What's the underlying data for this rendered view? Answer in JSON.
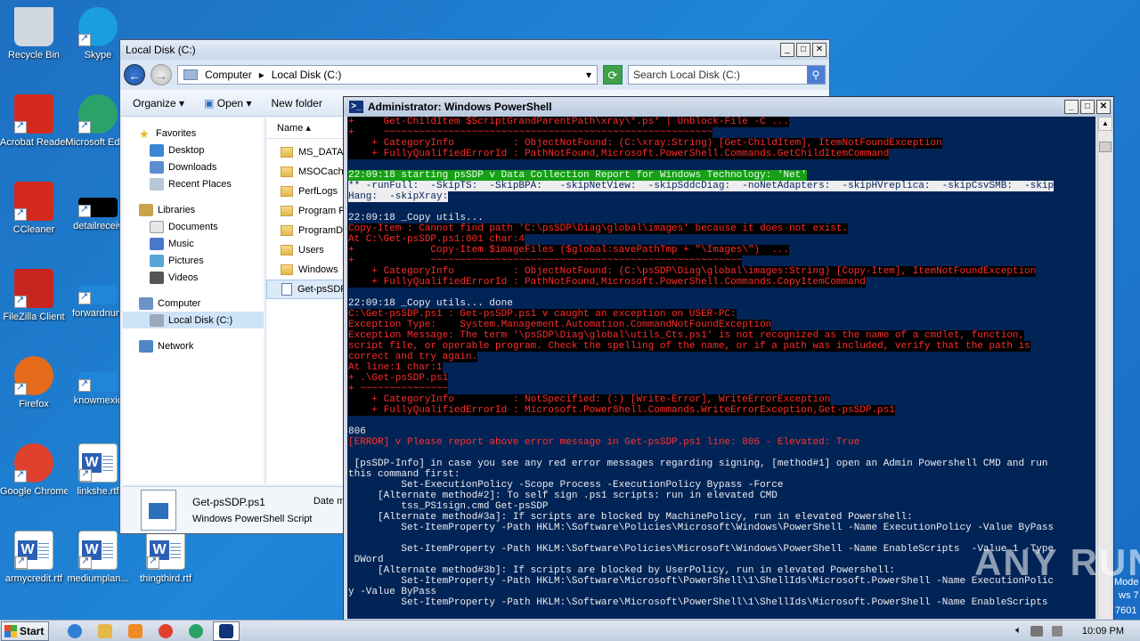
{
  "desktop_icons": [
    {
      "label": "Recycle Bin",
      "icon": "recycle-bin-icon",
      "color": "#cfd8e0"
    },
    {
      "label": "Skype",
      "icon": "skype-icon",
      "color": "#1a9ee2"
    },
    {
      "label": "Acrobat Reader DC",
      "icon": "acrobat-icon",
      "color": "#d32a1d"
    },
    {
      "label": "Microsoft Edge",
      "icon": "edge-icon",
      "color": "#2aa36a"
    },
    {
      "label": "CCleaner",
      "icon": "ccleaner-icon",
      "color": "#d32a1d"
    },
    {
      "label": "detailreceiv",
      "icon": "blank-file-icon",
      "color": "#000000"
    },
    {
      "label": "FileZilla Client",
      "icon": "filezilla-icon",
      "color": "#c9251f"
    },
    {
      "label": "forwardnum",
      "icon": "blank-file-icon",
      "color": "#1f86d8"
    },
    {
      "label": "Firefox",
      "icon": "firefox-icon",
      "color": "#e56a1a"
    },
    {
      "label": "knowmexic",
      "icon": "blank-file-icon",
      "color": "#1f86d8"
    },
    {
      "label": "Google Chrome",
      "icon": "chrome-icon",
      "color": "#e0412f"
    },
    {
      "label": "linkshe.rtf",
      "icon": "word-doc-icon",
      "color": "#2b5fb4"
    },
    {
      "label": "armycredit.rtf",
      "icon": "word-doc-icon",
      "color": "#2b5fb4"
    },
    {
      "label": "mediumplan...",
      "icon": "word-doc-icon",
      "color": "#2b5fb4"
    },
    {
      "label": "thingthird.rtf",
      "icon": "word-doc-icon",
      "color": "#2b5fb4"
    }
  ],
  "explorer": {
    "title": "Local Disk (C:)",
    "address": [
      "Computer",
      "Local Disk (C:)"
    ],
    "search_placeholder": "Search Local Disk (C:)",
    "commands": [
      "Organize",
      "Open",
      "New folder"
    ],
    "nav": {
      "favorites": "Favorites",
      "favorites_items": [
        "Desktop",
        "Downloads",
        "Recent Places"
      ],
      "libraries": "Libraries",
      "libraries_items": [
        "Documents",
        "Music",
        "Pictures",
        "Videos"
      ],
      "computer": "Computer",
      "computer_items": [
        "Local Disk (C:)"
      ],
      "network": "Network"
    },
    "column_name": "Name",
    "files": [
      "MS_DATA",
      "MSOCache",
      "PerfLogs",
      "Program Fi",
      "ProgramDa",
      "Users",
      "Windows",
      "Get-psSDP"
    ],
    "details": {
      "name": "Get-psSDP.ps1",
      "type": "Windows PowerShell Script",
      "date_label": "Date mo"
    }
  },
  "powershell": {
    "title": "Administrator: Windows PowerShell",
    "lines": [
      {
        "t": "+     Get-ChildItem $ScriptGrandParentPath\\xray\\*.ps* | Unblock-File -C ...",
        "c": "errbg"
      },
      {
        "t": "+     ~~~~~~~~~~~~~~~~~~~~~~~~~~~~~~~~~~~~~~~~~~~~~~~~~~~~~~~~",
        "c": "errbg"
      },
      {
        "t": "    + CategoryInfo          : ObjectNotFound: (C:\\xray:String) [Get-ChildItem], ItemNotFoundException",
        "c": "errbg"
      },
      {
        "t": "    + FullyQualifiedErrorId : PathNotFound,Microsoft.PowerShell.Commands.GetChildItemCommand",
        "c": "errbg"
      },
      {
        "t": "",
        "c": ""
      },
      {
        "t": "22:09:18 starting psSDP v Data Collection Report for Windows Technology: 'Net'",
        "c": "grn"
      },
      {
        "t": "** -runFull:  -SkipTS:  -SkipBPA:   -skipNetView:  -skipSddcDiag:  -noNetAdapters:  -skipHVreplica:  -skipCsvSMB:  -skip",
        "c": "hl"
      },
      {
        "t": "Hang:  -skipXray:",
        "c": "hl"
      },
      {
        "t": "",
        "c": ""
      },
      {
        "t": "22:09:18 _Copy utils...",
        "c": ""
      },
      {
        "t": "Copy-Item : Cannot find path 'C:\\psSDP\\Diag\\global\\images' because it does not exist.",
        "c": "errbg"
      },
      {
        "t": "At C:\\Get-psSDP.ps1:801 char:4",
        "c": "errbg"
      },
      {
        "t": "+             Copy-Item $imageFiles ($global:savePathTmp + \"\\Images\\\")  ...",
        "c": "errbg"
      },
      {
        "t": "+             ~~~~~~~~~~~~~~~~~~~~~~~~~~~~~~~~~~~~~~~~~~~~~~~~~~~~~",
        "c": "errbg"
      },
      {
        "t": "    + CategoryInfo          : ObjectNotFound: (C:\\psSDP\\Diag\\global\\images:String) [Copy-Item], ItemNotFoundException",
        "c": "errbg"
      },
      {
        "t": "    + FullyQualifiedErrorId : PathNotFound,Microsoft.PowerShell.Commands.CopyItemCommand",
        "c": "errbg"
      },
      {
        "t": "",
        "c": ""
      },
      {
        "t": "22:09:18 _Copy utils... done",
        "c": ""
      },
      {
        "t": "C:\\Get-psSDP.ps1 : Get-psSDP.ps1 v caught an exception on USER-PC:",
        "c": "errbg"
      },
      {
        "t": "Exception Type:    System.Management.Automation.CommandNotFoundException",
        "c": "errbg"
      },
      {
        "t": "Exception Message: The term '\\psSDP\\Diag\\global\\utils_Cts.ps1' is not recognized as the name of a cmdlet, function,",
        "c": "errbg"
      },
      {
        "t": "script file, or operable program. Check the spelling of the name, or if a path was included, verify that the path is",
        "c": "errbg"
      },
      {
        "t": "correct and try again.",
        "c": "errbg"
      },
      {
        "t": "At line:1 char:1",
        "c": "errbg"
      },
      {
        "t": "+ .\\Get-psSDP.ps1",
        "c": "errbg"
      },
      {
        "t": "+ ~~~~~~~~~~~~~~~",
        "c": "errbg"
      },
      {
        "t": "    + CategoryInfo          : NotSpecified: (:) [Write-Error], WriteErrorException",
        "c": "errbg"
      },
      {
        "t": "    + FullyQualifiedErrorId : Microsoft.PowerShell.Commands.WriteErrorException,Get-psSDP.ps1",
        "c": "errbg"
      },
      {
        "t": "",
        "c": ""
      },
      {
        "t": "806",
        "c": ""
      },
      {
        "t": "[ERROR] v Please report above error message in Get-psSDP.ps1 line: 806 - Elevated: True",
        "c": "err"
      },
      {
        "t": "",
        "c": ""
      },
      {
        "t": " [psSDP-Info] in case you see any red error messages regarding signing, [method#1] open an Admin Powershell CMD and run",
        "c": ""
      },
      {
        "t": "this command first:",
        "c": ""
      },
      {
        "t": "         Set-ExecutionPolicy -Scope Process -ExecutionPolicy Bypass -Force",
        "c": ""
      },
      {
        "t": "     [Alternate method#2]: To self sign .ps1 scripts: run in elevated CMD",
        "c": ""
      },
      {
        "t": "         tss_PS1sign.cmd Get-psSDP",
        "c": ""
      },
      {
        "t": "     [Alternate method#3a]: If scripts are blocked by MachinePolicy, run in elevated Powershell:",
        "c": ""
      },
      {
        "t": "         Set-ItemProperty -Path HKLM:\\Software\\Policies\\Microsoft\\Windows\\PowerShell -Name ExecutionPolicy -Value ByPass",
        "c": ""
      },
      {
        "t": "",
        "c": ""
      },
      {
        "t": "         Set-ItemProperty -Path HKLM:\\Software\\Policies\\Microsoft\\Windows\\PowerShell -Name EnableScripts  -Value 1 -Type",
        "c": ""
      },
      {
        "t": " DWord",
        "c": ""
      },
      {
        "t": "     [Alternate method#3b]: If scripts are blocked by UserPolicy, run in elevated Powershell:",
        "c": ""
      },
      {
        "t": "         Set-ItemProperty -Path HKLM:\\Software\\Microsoft\\PowerShell\\1\\ShellIds\\Microsoft.PowerShell -Name ExecutionPolic",
        "c": ""
      },
      {
        "t": "y -Value ByPass",
        "c": ""
      },
      {
        "t": "         Set-ItemProperty -Path HKLM:\\Software\\Microsoft\\PowerShell\\1\\ShellIds\\Microsoft.PowerShell -Name EnableScripts",
        "c": ""
      }
    ]
  },
  "taskbar": {
    "start_label": "Start",
    "clock": "10:09 PM",
    "pinned": [
      {
        "icon": "ie-icon",
        "color": "#2f7fd8"
      },
      {
        "icon": "explorer-icon",
        "color": "#e5b84a"
      },
      {
        "icon": "media-player-icon",
        "color": "#f08a24"
      },
      {
        "icon": "chrome-icon",
        "color": "#e0412f"
      },
      {
        "icon": "edge-icon",
        "color": "#2aa36a"
      },
      {
        "icon": "powershell-icon",
        "color": "#12347a"
      }
    ]
  },
  "watermark": "ANY RUN",
  "win_edge_text": [
    "Mode",
    "ws 7",
    "7601"
  ]
}
